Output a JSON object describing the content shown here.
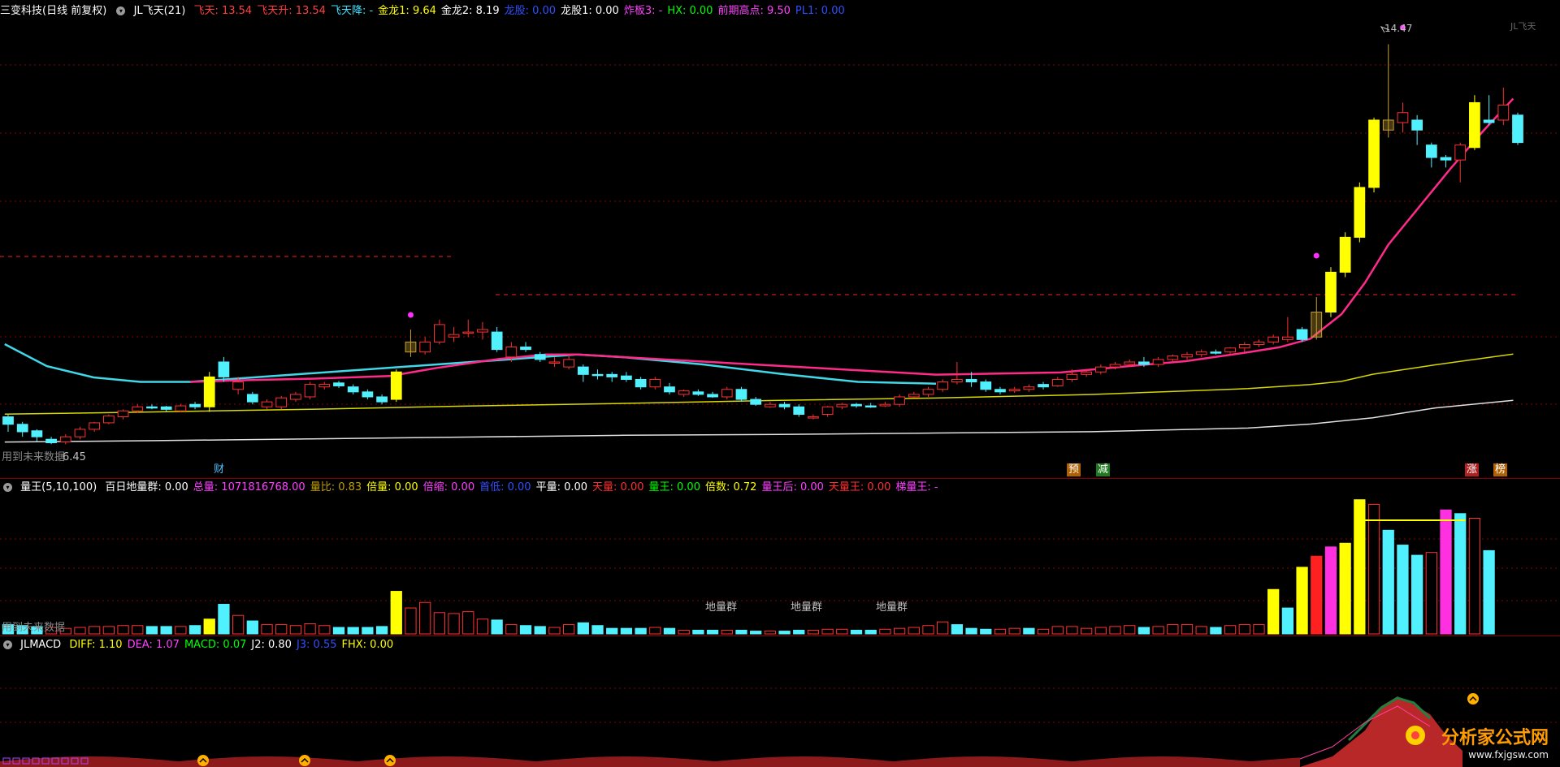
{
  "main_header": {
    "title": "三变科技(日线 前复权)",
    "indicator": "JL飞天(21)",
    "items": [
      {
        "label": "飞天: 13.54",
        "color": "#ff4040"
      },
      {
        "label": "飞天升: 13.54",
        "color": "#ff4040"
      },
      {
        "label": "飞天降: -",
        "color": "#40e0ff"
      },
      {
        "label": "金龙1: 9.64",
        "color": "#ffff00"
      },
      {
        "label": "金龙2: 8.19",
        "color": "#ffffff"
      },
      {
        "label": "龙股: 0.00",
        "color": "#3050ff"
      },
      {
        "label": "龙股1: 0.00",
        "color": "#ffffff"
      },
      {
        "label": "炸板3: -",
        "color": "#ff40ff"
      },
      {
        "label": "HX: 0.00",
        "color": "#00ff00"
      },
      {
        "label": "前期高点: 9.50",
        "color": "#ff40ff"
      },
      {
        "label": "PL1: 0.00",
        "color": "#3050ff"
      }
    ]
  },
  "main_labels": {
    "high_price": "14.47",
    "low_price": "6.45",
    "future_text": "用到未来数据",
    "marker_cai": "财",
    "marker_yu": "预",
    "marker_jian": "减",
    "marker_zhang": "涨",
    "marker_bang": "榜",
    "top_right": "JL飞天"
  },
  "volume_header": {
    "indicator": "量王(5,10,100)",
    "items": [
      {
        "label": "百日地量群: 0.00",
        "color": "#ffffff"
      },
      {
        "label": "总量: 1071816768.00",
        "color": "#ff40ff"
      },
      {
        "label": "量比: 0.83",
        "color": "#c0a000"
      },
      {
        "label": "倍量: 0.00",
        "color": "#ffff00"
      },
      {
        "label": "倍缩: 0.00",
        "color": "#ff40ff"
      },
      {
        "label": "首低: 0.00",
        "color": "#3050ff"
      },
      {
        "label": "平量: 0.00",
        "color": "#ffffff"
      },
      {
        "label": "天量: 0.00",
        "color": "#ff3030"
      },
      {
        "label": "量王: 0.00",
        "color": "#00ff00"
      },
      {
        "label": "倍数: 0.72",
        "color": "#ffff00"
      },
      {
        "label": "量王后: 0.00",
        "color": "#ff40ff"
      },
      {
        "label": "天量王: 0.00",
        "color": "#ff3030"
      },
      {
        "label": "梯量王: -",
        "color": "#ff40ff"
      }
    ],
    "dl_label_1": "地量群",
    "dl_label_2": "地量群",
    "dl_label_3": "地量群",
    "future_text": "用到未来数据"
  },
  "macd_header": {
    "indicator": "JLMACD",
    "items": [
      {
        "label": "DIFF: 1.10",
        "color": "#ffff00"
      },
      {
        "label": "DEA: 1.07",
        "color": "#ff40ff"
      },
      {
        "label": "MACD: 0.07",
        "color": "#00ff00"
      },
      {
        "label": "J2: 0.80",
        "color": "#ffffff"
      },
      {
        "label": "J3: 0.55",
        "color": "#3050ff"
      },
      {
        "label": "FHX: 0.00",
        "color": "#ffff00"
      }
    ]
  },
  "watermark": {
    "title": "分析家公式网",
    "url": "www.fxjgsw.com"
  },
  "colors": {
    "up": "#ff3030",
    "down": "#50f0ff",
    "special": "#ffff00",
    "ma_pink": "#ff2a8a",
    "ma_cyan": "#40d8e8",
    "ma_yellow": "#d8d800",
    "ma_white": "#e0e0e0",
    "grid": "#8a0000"
  },
  "price_scale": {
    "min": 6.0,
    "max": 15.0
  },
  "candles": [
    [
      7.0,
      6.85,
      7.05,
      6.7,
      "d"
    ],
    [
      6.85,
      6.7,
      6.9,
      6.6,
      "d"
    ],
    [
      6.72,
      6.6,
      6.75,
      6.5,
      "d"
    ],
    [
      6.55,
      6.48,
      6.6,
      6.45,
      "d"
    ],
    [
      6.5,
      6.6,
      6.65,
      6.45,
      "u"
    ],
    [
      6.6,
      6.75,
      6.8,
      6.55,
      "u"
    ],
    [
      6.75,
      6.88,
      6.9,
      6.7,
      "u"
    ],
    [
      6.88,
      7.02,
      7.05,
      6.85,
      "u"
    ],
    [
      7.0,
      7.12,
      7.15,
      6.95,
      "u"
    ],
    [
      7.12,
      7.2,
      7.25,
      7.08,
      "u"
    ],
    [
      7.2,
      7.2,
      7.25,
      7.15,
      "d"
    ],
    [
      7.2,
      7.15,
      7.22,
      7.1,
      "d"
    ],
    [
      7.12,
      7.22,
      7.26,
      7.1,
      "u"
    ],
    [
      7.2,
      7.25,
      7.3,
      7.15,
      "d"
    ],
    [
      7.2,
      7.8,
      7.9,
      7.1,
      "s"
    ],
    [
      7.8,
      8.1,
      8.2,
      7.7,
      "d"
    ],
    [
      7.7,
      7.55,
      7.8,
      7.45,
      "u"
    ],
    [
      7.45,
      7.3,
      7.5,
      7.25,
      "d"
    ],
    [
      7.3,
      7.2,
      7.35,
      7.15,
      "u"
    ],
    [
      7.2,
      7.38,
      7.42,
      7.15,
      "u"
    ],
    [
      7.35,
      7.45,
      7.5,
      7.3,
      "u"
    ],
    [
      7.4,
      7.65,
      7.7,
      7.35,
      "u"
    ],
    [
      7.6,
      7.65,
      7.7,
      7.55,
      "u"
    ],
    [
      7.68,
      7.62,
      7.72,
      7.58,
      "d"
    ],
    [
      7.6,
      7.5,
      7.65,
      7.45,
      "d"
    ],
    [
      7.5,
      7.4,
      7.55,
      7.35,
      "d"
    ],
    [
      7.4,
      7.3,
      7.45,
      7.25,
      "d"
    ],
    [
      7.35,
      7.9,
      7.95,
      7.3,
      "s"
    ],
    [
      8.3,
      8.5,
      8.75,
      8.2,
      "o"
    ],
    [
      8.3,
      8.5,
      8.6,
      8.25,
      "u"
    ],
    [
      8.5,
      8.85,
      8.95,
      8.45,
      "u"
    ],
    [
      8.6,
      8.65,
      8.8,
      8.5,
      "u"
    ],
    [
      8.7,
      8.7,
      8.95,
      8.6,
      "u"
    ],
    [
      8.75,
      8.7,
      8.9,
      8.55,
      "u"
    ],
    [
      8.7,
      8.35,
      8.8,
      8.3,
      "d"
    ],
    [
      8.4,
      8.2,
      8.5,
      8.1,
      "u"
    ],
    [
      8.35,
      8.4,
      8.5,
      8.3,
      "d"
    ],
    [
      8.25,
      8.15,
      8.3,
      8.1,
      "d"
    ],
    [
      8.1,
      8.1,
      8.2,
      8.0,
      "u"
    ],
    [
      8.15,
      8.0,
      8.25,
      7.95,
      "u"
    ],
    [
      8.0,
      7.85,
      8.05,
      7.7,
      "d"
    ],
    [
      7.85,
      7.85,
      7.95,
      7.75,
      "d"
    ],
    [
      7.85,
      7.8,
      7.9,
      7.7,
      "d"
    ],
    [
      7.82,
      7.75,
      7.9,
      7.7,
      "d"
    ],
    [
      7.75,
      7.6,
      7.8,
      7.55,
      "d"
    ],
    [
      7.6,
      7.75,
      7.8,
      7.55,
      "u"
    ],
    [
      7.6,
      7.5,
      7.68,
      7.45,
      "d"
    ],
    [
      7.52,
      7.45,
      7.55,
      7.4,
      "u"
    ],
    [
      7.5,
      7.45,
      7.55,
      7.42,
      "d"
    ],
    [
      7.45,
      7.4,
      7.5,
      7.38,
      "d"
    ],
    [
      7.4,
      7.55,
      7.6,
      7.35,
      "u"
    ],
    [
      7.55,
      7.35,
      7.6,
      7.3,
      "d"
    ],
    [
      7.35,
      7.25,
      7.4,
      7.22,
      "d"
    ],
    [
      7.25,
      7.2,
      7.3,
      7.18,
      "u"
    ],
    [
      7.25,
      7.2,
      7.3,
      7.15,
      "d"
    ],
    [
      7.2,
      7.05,
      7.25,
      7.0,
      "d"
    ],
    [
      7.0,
      7.0,
      7.05,
      6.95,
      "u"
    ],
    [
      7.05,
      7.2,
      7.22,
      7.0,
      "u"
    ],
    [
      7.2,
      7.25,
      7.28,
      7.15,
      "u"
    ],
    [
      7.25,
      7.22,
      7.28,
      7.18,
      "d"
    ],
    [
      7.2,
      7.22,
      7.28,
      7.18,
      "d"
    ],
    [
      7.22,
      7.25,
      7.3,
      7.2,
      "u"
    ],
    [
      7.25,
      7.4,
      7.45,
      7.2,
      "u"
    ],
    [
      7.4,
      7.45,
      7.5,
      7.38,
      "u"
    ],
    [
      7.45,
      7.55,
      7.6,
      7.4,
      "u"
    ],
    [
      7.55,
      7.7,
      7.75,
      7.5,
      "u"
    ],
    [
      7.7,
      7.75,
      8.1,
      7.65,
      "u"
    ],
    [
      7.75,
      7.7,
      7.9,
      7.6,
      "d"
    ],
    [
      7.7,
      7.55,
      7.75,
      7.5,
      "d"
    ],
    [
      7.55,
      7.5,
      7.6,
      7.45,
      "d"
    ],
    [
      7.52,
      7.55,
      7.6,
      7.48,
      "u"
    ],
    [
      7.55,
      7.6,
      7.65,
      7.5,
      "u"
    ],
    [
      7.6,
      7.65,
      7.7,
      7.55,
      "d"
    ],
    [
      7.62,
      7.75,
      7.8,
      7.6,
      "u"
    ],
    [
      7.75,
      7.85,
      7.95,
      7.7,
      "u"
    ],
    [
      7.85,
      7.9,
      7.95,
      7.8,
      "u"
    ],
    [
      7.9,
      8.0,
      8.05,
      7.85,
      "u"
    ],
    [
      8.0,
      8.05,
      8.1,
      7.95,
      "u"
    ],
    [
      8.05,
      8.1,
      8.15,
      8.0,
      "u"
    ],
    [
      8.1,
      8.05,
      8.2,
      8.0,
      "d"
    ],
    [
      8.05,
      8.15,
      8.2,
      8.0,
      "u"
    ],
    [
      8.15,
      8.22,
      8.25,
      8.1,
      "u"
    ],
    [
      8.2,
      8.25,
      8.3,
      8.15,
      "u"
    ],
    [
      8.25,
      8.3,
      8.35,
      8.2,
      "u"
    ],
    [
      8.3,
      8.3,
      8.35,
      8.25,
      "d"
    ],
    [
      8.3,
      8.38,
      8.4,
      8.25,
      "u"
    ],
    [
      8.38,
      8.45,
      8.5,
      8.3,
      "u"
    ],
    [
      8.45,
      8.5,
      8.55,
      8.4,
      "u"
    ],
    [
      8.5,
      8.6,
      8.65,
      8.45,
      "u"
    ],
    [
      8.6,
      8.55,
      9.0,
      8.5,
      "u"
    ],
    [
      8.55,
      8.75,
      8.8,
      8.5,
      "d"
    ],
    [
      8.6,
      9.1,
      9.4,
      8.55,
      "o"
    ],
    [
      9.1,
      9.9,
      10.0,
      9.0,
      "s"
    ],
    [
      9.9,
      10.6,
      10.7,
      9.8,
      "s"
    ],
    [
      10.6,
      11.6,
      11.7,
      10.5,
      "s"
    ],
    [
      11.6,
      12.95,
      13.0,
      11.5,
      "s"
    ],
    [
      12.75,
      12.95,
      14.47,
      12.6,
      "o"
    ],
    [
      12.9,
      13.1,
      13.3,
      12.7,
      "u"
    ],
    [
      12.95,
      12.75,
      13.05,
      12.45,
      "d"
    ],
    [
      12.45,
      12.2,
      12.5,
      12.0,
      "d"
    ],
    [
      12.2,
      12.15,
      12.25,
      12.0,
      "d"
    ],
    [
      12.15,
      12.45,
      12.5,
      11.7,
      "u"
    ],
    [
      12.4,
      13.3,
      13.45,
      12.35,
      "s"
    ],
    [
      12.95,
      12.9,
      13.45,
      12.85,
      "d"
    ],
    [
      12.95,
      13.25,
      13.6,
      12.85,
      "u"
    ],
    [
      13.05,
      12.5,
      13.1,
      12.45,
      "d"
    ]
  ],
  "volumes": [
    [
      1.0,
      "d"
    ],
    [
      0.9,
      "d"
    ],
    [
      0.8,
      "d"
    ],
    [
      0.7,
      "u"
    ],
    [
      0.6,
      "u"
    ],
    [
      0.7,
      "u"
    ],
    [
      0.8,
      "u"
    ],
    [
      0.8,
      "u"
    ],
    [
      0.9,
      "u"
    ],
    [
      0.9,
      "u"
    ],
    [
      0.8,
      "d"
    ],
    [
      0.8,
      "d"
    ],
    [
      0.8,
      "u"
    ],
    [
      0.9,
      "d"
    ],
    [
      1.6,
      "s"
    ],
    [
      3.2,
      "d"
    ],
    [
      2.0,
      "u"
    ],
    [
      1.4,
      "d"
    ],
    [
      1.0,
      "u"
    ],
    [
      1.0,
      "u"
    ],
    [
      0.9,
      "u"
    ],
    [
      1.1,
      "u"
    ],
    [
      0.9,
      "u"
    ],
    [
      0.7,
      "d"
    ],
    [
      0.7,
      "d"
    ],
    [
      0.7,
      "d"
    ],
    [
      0.8,
      "d"
    ],
    [
      4.6,
      "s"
    ],
    [
      2.8,
      "u"
    ],
    [
      3.4,
      "u"
    ],
    [
      2.3,
      "u"
    ],
    [
      2.2,
      "u"
    ],
    [
      2.4,
      "u"
    ],
    [
      1.6,
      "u"
    ],
    [
      1.5,
      "d"
    ],
    [
      1.0,
      "u"
    ],
    [
      0.9,
      "d"
    ],
    [
      0.8,
      "d"
    ],
    [
      0.7,
      "u"
    ],
    [
      1.0,
      "u"
    ],
    [
      1.2,
      "d"
    ],
    [
      0.9,
      "d"
    ],
    [
      0.6,
      "d"
    ],
    [
      0.6,
      "d"
    ],
    [
      0.6,
      "d"
    ],
    [
      0.7,
      "u"
    ],
    [
      0.6,
      "d"
    ],
    [
      0.4,
      "u"
    ],
    [
      0.4,
      "d"
    ],
    [
      0.4,
      "d"
    ],
    [
      0.4,
      "u"
    ],
    [
      0.4,
      "d"
    ],
    [
      0.3,
      "d"
    ],
    [
      0.3,
      "u"
    ],
    [
      0.3,
      "d"
    ],
    [
      0.4,
      "d"
    ],
    [
      0.4,
      "u"
    ],
    [
      0.5,
      "u"
    ],
    [
      0.5,
      "u"
    ],
    [
      0.4,
      "d"
    ],
    [
      0.4,
      "d"
    ],
    [
      0.5,
      "u"
    ],
    [
      0.6,
      "u"
    ],
    [
      0.7,
      "u"
    ],
    [
      0.9,
      "u"
    ],
    [
      1.3,
      "u"
    ],
    [
      1.0,
      "d"
    ],
    [
      0.6,
      "d"
    ],
    [
      0.5,
      "d"
    ],
    [
      0.5,
      "u"
    ],
    [
      0.6,
      "u"
    ],
    [
      0.6,
      "d"
    ],
    [
      0.5,
      "u"
    ],
    [
      0.8,
      "u"
    ],
    [
      0.8,
      "u"
    ],
    [
      0.6,
      "u"
    ],
    [
      0.7,
      "u"
    ],
    [
      0.8,
      "u"
    ],
    [
      0.9,
      "u"
    ],
    [
      0.7,
      "d"
    ],
    [
      0.8,
      "u"
    ],
    [
      1.0,
      "u"
    ],
    [
      1.0,
      "u"
    ],
    [
      0.8,
      "u"
    ],
    [
      0.7,
      "d"
    ],
    [
      0.9,
      "u"
    ],
    [
      1.0,
      "u"
    ],
    [
      1.0,
      "u"
    ],
    [
      4.8,
      "s"
    ],
    [
      2.8,
      "d"
    ],
    [
      7.2,
      "s"
    ],
    [
      8.4,
      "r"
    ],
    [
      9.4,
      "m"
    ],
    [
      9.8,
      "s"
    ],
    [
      14.5,
      "s"
    ],
    [
      14.0,
      "u"
    ],
    [
      11.2,
      "d"
    ],
    [
      9.6,
      "d"
    ],
    [
      8.5,
      "d"
    ],
    [
      8.8,
      "u"
    ],
    [
      13.4,
      "m"
    ],
    [
      13.0,
      "d"
    ],
    [
      12.5,
      "u"
    ],
    [
      9.0,
      "d"
    ]
  ],
  "ma_pink": [
    [
      0.122,
      18.9
    ],
    [
      0.16,
      19.3
    ],
    [
      0.2,
      19.6
    ],
    [
      0.25,
      20.2
    ],
    [
      0.28,
      22.0
    ],
    [
      0.32,
      24.0
    ],
    [
      0.35,
      25.0
    ],
    [
      0.37,
      25.0
    ],
    [
      0.6,
      20.5
    ],
    [
      0.68,
      21.0
    ],
    [
      0.72,
      22.3
    ],
    [
      0.76,
      23.5
    ],
    [
      0.8,
      25.5
    ],
    [
      0.82,
      26.6
    ],
    [
      0.84,
      28.5
    ],
    [
      0.86,
      34.0
    ],
    [
      0.875,
      41.0
    ],
    [
      0.89,
      49.5
    ],
    [
      0.91,
      58.0
    ],
    [
      0.93,
      66.5
    ],
    [
      0.95,
      74.5
    ],
    [
      0.97,
      82.0
    ]
  ],
  "ma_cyan": [
    [
      0.003,
      27.3
    ],
    [
      0.03,
      22.4
    ],
    [
      0.06,
      19.9
    ],
    [
      0.09,
      18.9
    ],
    [
      0.122,
      18.9
    ],
    [
      0.37,
      25.0
    ],
    [
      0.4,
      24.4
    ],
    [
      0.45,
      22.8
    ],
    [
      0.5,
      20.7
    ],
    [
      0.55,
      18.9
    ],
    [
      0.6,
      18.5
    ]
  ],
  "ma_yellow": [
    [
      0.003,
      11.7
    ],
    [
      0.1,
      12.2
    ],
    [
      0.2,
      12.8
    ],
    [
      0.3,
      13.5
    ],
    [
      0.4,
      14.1
    ],
    [
      0.5,
      14.8
    ],
    [
      0.6,
      15.3
    ],
    [
      0.7,
      16.1
    ],
    [
      0.8,
      17.4
    ],
    [
      0.84,
      18.3
    ],
    [
      0.86,
      19.0
    ],
    [
      0.88,
      20.6
    ],
    [
      0.92,
      22.7
    ],
    [
      0.97,
      25.1
    ]
  ],
  "ma_white": [
    [
      0.003,
      5.5
    ],
    [
      0.1,
      5.8
    ],
    [
      0.2,
      6.2
    ],
    [
      0.3,
      6.6
    ],
    [
      0.4,
      7.0
    ],
    [
      0.5,
      7.2
    ],
    [
      0.6,
      7.5
    ],
    [
      0.7,
      7.8
    ],
    [
      0.8,
      8.6
    ],
    [
      0.84,
      9.5
    ],
    [
      0.88,
      10.9
    ],
    [
      0.92,
      13.1
    ],
    [
      0.97,
      14.8
    ]
  ]
}
